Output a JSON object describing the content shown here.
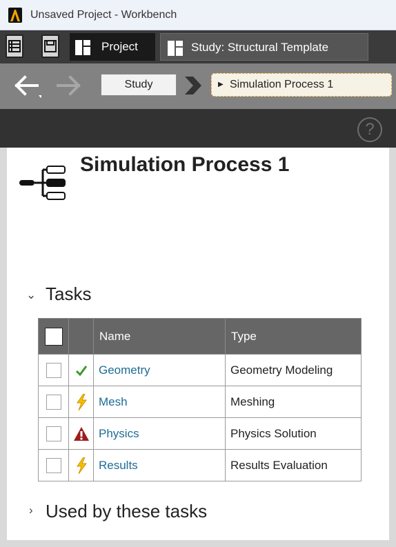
{
  "window": {
    "title": "Unsaved Project - Workbench",
    "logo": "workbench-logo-icon",
    "accent": "#f0a500"
  },
  "tabbar": {
    "buttons": [
      "list-icon",
      "save-icon"
    ],
    "tabs": [
      {
        "label": "Project",
        "active": true,
        "icon": "project-tab-icon"
      },
      {
        "label": "Study: Structural Template",
        "active": false,
        "icon": "study-tab-icon"
      }
    ]
  },
  "navigation": {
    "back_icon": "back-arrow-icon",
    "forward_icon": "forward-arrow-icon",
    "breadcrumbs": [
      {
        "label": "Study"
      },
      {
        "label": "Simulation Process 1",
        "current": true
      }
    ],
    "help_icon": "help-icon"
  },
  "page": {
    "title": "Simulation Process 1",
    "icon": "process-tree-icon"
  },
  "tasks_section": {
    "title": "Tasks",
    "expanded": true,
    "columns": [
      "",
      "",
      "Name",
      "Type"
    ],
    "rows": [
      {
        "name": "Geometry",
        "type": "Geometry Modeling",
        "status": "check-icon",
        "checked": false
      },
      {
        "name": "Mesh",
        "type": "Meshing",
        "status": "lightning-icon",
        "checked": false
      },
      {
        "name": "Physics",
        "type": "Physics Solution",
        "status": "warning-icon",
        "checked": false
      },
      {
        "name": "Results",
        "type": "Results Evaluation",
        "status": "lightning-icon",
        "checked": false
      }
    ]
  },
  "used_by_section": {
    "title": "Used by these tasks",
    "expanded": false
  },
  "colors": {
    "link": "#1d6c96",
    "table_header": "#666666",
    "check": "#3a9a2a",
    "lightning": "#f2c200",
    "warning": "#9b1c1c",
    "breadcrumb_current_border": "#e4a93a"
  }
}
